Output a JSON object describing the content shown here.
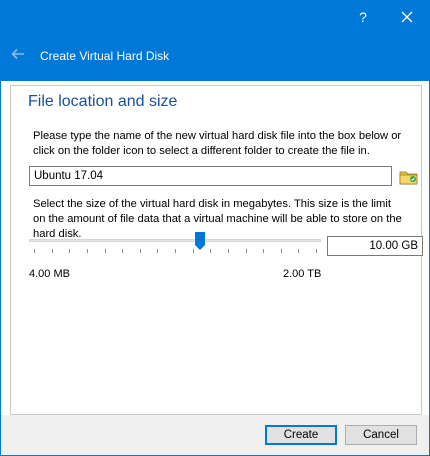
{
  "titlebar": {
    "help_label": "?",
    "close_icon": "close-icon",
    "back_icon": "back-arrow-icon",
    "wizard_title": "Create Virtual Hard Disk",
    "background": "#0078d7"
  },
  "page": {
    "heading": "File location and size",
    "location_description": "Please type the name of the new virtual hard disk file into the box below or click on the folder icon to select a different folder to create the file in.",
    "file_name_value": "Ubuntu 17.04",
    "folder_icon": "folder-icon",
    "size_description": "Select the size of the virtual hard disk in megabytes. This size is the limit on the amount of file data that a virtual machine will be able to store on the hard disk.",
    "size_slider": {
      "position_fraction": 0.59,
      "tick_count": 17
    },
    "size_value": "10.00 GB",
    "min_label": "4.00 MB",
    "max_label": "2.00 TB"
  },
  "footer": {
    "create_label": "Create",
    "cancel_label": "Cancel"
  }
}
